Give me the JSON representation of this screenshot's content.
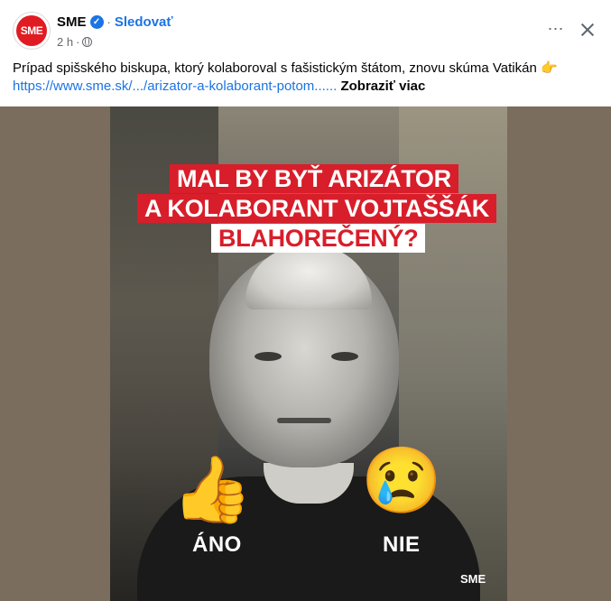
{
  "post": {
    "page_name": "SME",
    "avatar_text": "SME",
    "separator": "·",
    "follow_label": "Sledovať",
    "time": "2 h",
    "meta_separator": "·",
    "text": "Prípad spišského biskupa, ktorý kolaboroval s fašistickým štátom, znovu skúma Vatikán",
    "pointer_emoji": "👉",
    "link": "https://www.sme.sk/.../arizator-a-kolaborant-potom......",
    "see_more": "Zobraziť viac",
    "more_icon": "⋯"
  },
  "image": {
    "headline_lines": [
      "MAL BY BYŤ ARIZÁTOR",
      "A KOLABORANT VOJTAŠŠÁK",
      "BLAHOREČENÝ?"
    ],
    "choice_yes_emoji": "👍",
    "choice_yes_label": "ÁNO",
    "choice_no_emoji": "😢",
    "choice_no_label": "NIE",
    "watermark": "SME"
  },
  "colors": {
    "link": "#1b74e4",
    "verified": "#1b74e4",
    "headline_red": "#d81e2a",
    "brand_red": "#e11b22"
  }
}
